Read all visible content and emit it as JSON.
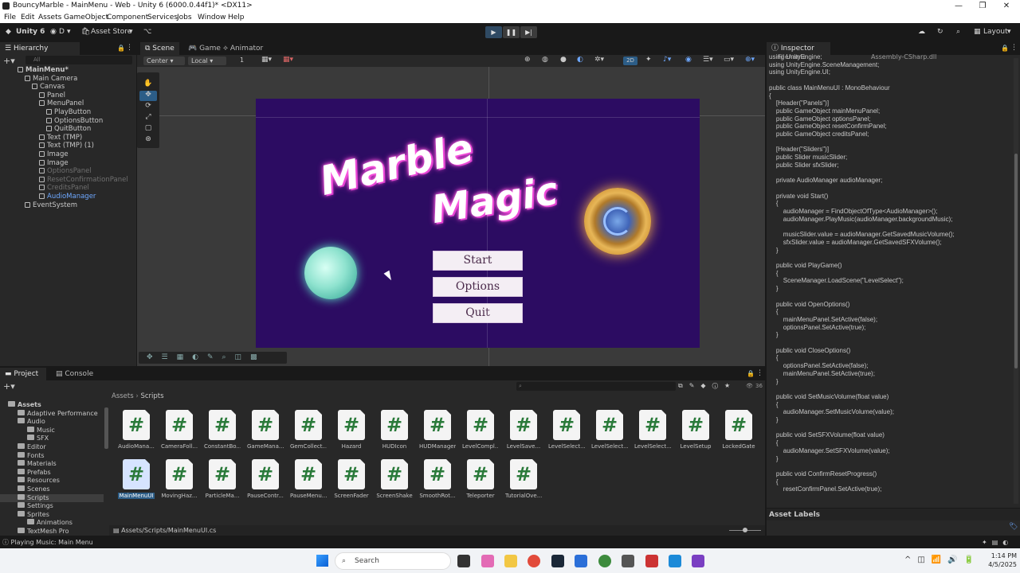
{
  "window": {
    "title": "BouncyMarble - MainMenu - Web - Unity 6 (6000.0.44f1)* <DX11>"
  },
  "menu": [
    "File",
    "Edit",
    "Assets",
    "GameObject",
    "Component",
    "Services",
    "Jobs",
    "Window",
    "Help"
  ],
  "toolbar": {
    "unity": "Unity 6",
    "account": "D",
    "asset_store": "Asset Store",
    "layout": "Layout"
  },
  "hierarchy": {
    "tab": "Hierarchy",
    "search_placeholder": "All",
    "rows": [
      {
        "label": "MainMenu*",
        "depth": 0,
        "style": "bold"
      },
      {
        "label": "Main Camera",
        "depth": 1,
        "style": ""
      },
      {
        "label": "Canvas",
        "depth": 2,
        "style": ""
      },
      {
        "label": "Panel",
        "depth": 3,
        "style": ""
      },
      {
        "label": "MenuPanel",
        "depth": 3,
        "style": ""
      },
      {
        "label": "PlayButton",
        "depth": 4,
        "style": ""
      },
      {
        "label": "OptionsButton",
        "depth": 4,
        "style": ""
      },
      {
        "label": "QuitButton",
        "depth": 4,
        "style": ""
      },
      {
        "label": "Text (TMP)",
        "depth": 3,
        "style": ""
      },
      {
        "label": "Text (TMP) (1)",
        "depth": 3,
        "style": ""
      },
      {
        "label": "Image",
        "depth": 3,
        "style": ""
      },
      {
        "label": "Image",
        "depth": 3,
        "style": ""
      },
      {
        "label": "OptionsPanel",
        "depth": 3,
        "style": "dim"
      },
      {
        "label": "ResetConfirmationPanel",
        "depth": 3,
        "style": "dim"
      },
      {
        "label": "CreditsPanel",
        "depth": 3,
        "style": "dim"
      },
      {
        "label": "AudioManager",
        "depth": 3,
        "style": "sel"
      },
      {
        "label": "EventSystem",
        "depth": 1,
        "style": ""
      }
    ]
  },
  "scene": {
    "tabs": [
      "Scene",
      "Game",
      "Animator"
    ],
    "pivot": "Center",
    "space": "Local",
    "grid": "1",
    "mode_2d": "2D",
    "game": {
      "title_line1": "Marble",
      "title_line2": "Magic",
      "buttons": [
        "Start",
        "Options",
        "Quit"
      ]
    }
  },
  "inspector": {
    "tab": "Inspector",
    "filename_label": "Filename",
    "filename_value": "Assembly-CSharp.dll",
    "code": "using UnityEngine;\nusing UnityEngine.SceneManagement;\nusing UnityEngine.UI;\n\npublic class MainMenuUI : MonoBehaviour\n{\n    [Header(\"Panels\")]\n    public GameObject mainMenuPanel;\n    public GameObject optionsPanel;\n    public GameObject resetConfirmPanel;\n    public GameObject creditsPanel;\n\n    [Header(\"Sliders\")]\n    public Slider musicSlider;\n    public Slider sfxSlider;\n\n    private AudioManager audioManager;\n\n    private void Start()\n    {\n        audioManager = FindObjectOfType<AudioManager>();\n        audioManager.PlayMusic(audioManager.backgroundMusic);\n\n        musicSlider.value = audioManager.GetSavedMusicVolume();\n        sfxSlider.value = audioManager.GetSavedSFXVolume();\n    }\n\n    public void PlayGame()\n    {\n        SceneManager.LoadScene(\"LevelSelect\");\n    }\n\n    public void OpenOptions()\n    {\n        mainMenuPanel.SetActive(false);\n        optionsPanel.SetActive(true);\n    }\n\n    public void CloseOptions()\n    {\n        optionsPanel.SetActive(false);\n        mainMenuPanel.SetActive(true);\n    }\n\n    public void SetMusicVolume(float value)\n    {\n        audioManager.SetMusicVolume(value);\n    }\n\n    public void SetSFXVolume(float value)\n    {\n        audioManager.SetSFXVolume(value);\n    }\n\n    public void ConfirmResetProgress()\n    {\n        resetConfirmPanel.SetActive(true);",
    "asset_labels": "Asset Labels"
  },
  "project": {
    "tabs": [
      "Project",
      "Console"
    ],
    "tree": [
      {
        "label": "Assets",
        "depth": 0,
        "bold": true
      },
      {
        "label": "Adaptive Performance",
        "depth": 1
      },
      {
        "label": "Audio",
        "depth": 1
      },
      {
        "label": "Music",
        "depth": 2
      },
      {
        "label": "SFX",
        "depth": 2
      },
      {
        "label": "Editor",
        "depth": 1
      },
      {
        "label": "Fonts",
        "depth": 1
      },
      {
        "label": "Materials",
        "depth": 1
      },
      {
        "label": "Prefabs",
        "depth": 1
      },
      {
        "label": "Resources",
        "depth": 1
      },
      {
        "label": "Scenes",
        "depth": 1
      },
      {
        "label": "Scripts",
        "depth": 1,
        "selected": true
      },
      {
        "label": "Settings",
        "depth": 1
      },
      {
        "label": "Sprites",
        "depth": 1
      },
      {
        "label": "Animations",
        "depth": 2
      },
      {
        "label": "TextMesh Pro",
        "depth": 1
      }
    ],
    "breadcrumb": [
      "Assets",
      "Scripts"
    ],
    "count": "36",
    "scripts_row1": [
      "AudioMana...",
      "CameraFoll...",
      "ConstantBo...",
      "GameMana...",
      "GemCollect...",
      "Hazard",
      "HUDIcon",
      "HUDManager",
      "LevelCompl...",
      "LevelSave...",
      "LevelSelect...",
      "LevelSelect...",
      "LevelSelect...",
      "LevelSetup",
      "LockedGate"
    ],
    "scripts_row2": [
      "MainMenuUI",
      "MovingHaz...",
      "ParticleMa...",
      "PauseContr...",
      "PauseMenu...",
      "ScreenFader",
      "ScreenShake",
      "SmoothRot...",
      "Teleporter",
      "TutorialOve..."
    ],
    "path": "Assets/Scripts/MainMenuUI.cs"
  },
  "status": {
    "message": "Playing Music: Main Menu"
  },
  "taskbar": {
    "search": "Search",
    "time": "1:14 PM",
    "date": "4/5/2025"
  }
}
